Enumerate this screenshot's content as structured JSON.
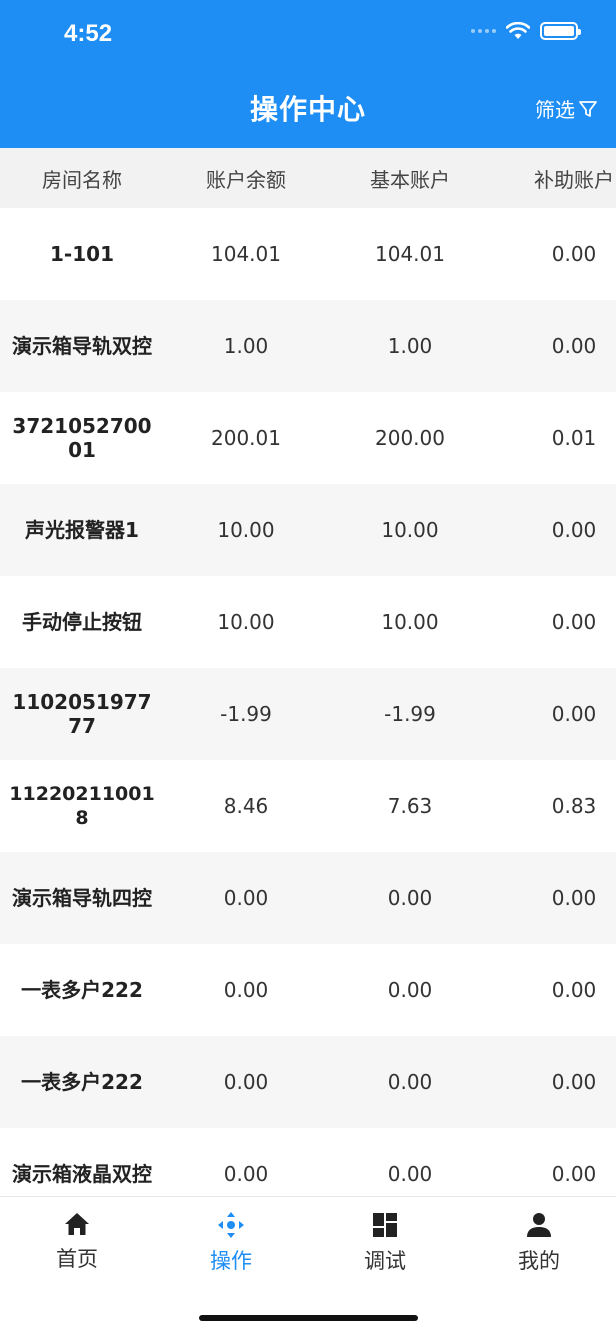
{
  "status_bar": {
    "time": "4:52"
  },
  "header": {
    "title": "操作中心",
    "filter_label": "筛选"
  },
  "table": {
    "columns": [
      "房间名称",
      "账户余额",
      "基本账户",
      "补助账户"
    ],
    "rows": [
      {
        "name": "1-101",
        "balance": "104.01",
        "basic": "104.01",
        "subsidy": "0.00"
      },
      {
        "name": "演示箱导轨双控",
        "balance": "1.00",
        "basic": "1.00",
        "subsidy": "0.00"
      },
      {
        "name": "372105270001",
        "balance": "200.01",
        "basic": "200.00",
        "subsidy": "0.01"
      },
      {
        "name": "声光报警器1",
        "balance": "10.00",
        "basic": "10.00",
        "subsidy": "0.00"
      },
      {
        "name": "手动停止按钮",
        "balance": "10.00",
        "basic": "10.00",
        "subsidy": "0.00"
      },
      {
        "name": "110205197777",
        "balance": "-1.99",
        "basic": "-1.99",
        "subsidy": "0.00"
      },
      {
        "name": "112202110018",
        "balance": "8.46",
        "basic": "7.63",
        "subsidy": "0.83"
      },
      {
        "name": "演示箱导轨四控",
        "balance": "0.00",
        "basic": "0.00",
        "subsidy": "0.00"
      },
      {
        "name": "一表多户222",
        "balance": "0.00",
        "basic": "0.00",
        "subsidy": "0.00"
      },
      {
        "name": "一表多户222",
        "balance": "0.00",
        "basic": "0.00",
        "subsidy": "0.00"
      },
      {
        "name": "演示箱液晶双控",
        "balance": "0.00",
        "basic": "0.00",
        "subsidy": "0.00"
      }
    ]
  },
  "tabbar": {
    "tabs": [
      {
        "label": "首页",
        "icon": "home-icon"
      },
      {
        "label": "操作",
        "icon": "operation-icon"
      },
      {
        "label": "调试",
        "icon": "dashboard-icon"
      },
      {
        "label": "我的",
        "icon": "user-icon"
      }
    ],
    "active_index": 1
  },
  "colors": {
    "primary": "#1E8EF5",
    "header_text": "#FFFFFF",
    "row_alt": "#F6F6F6"
  }
}
